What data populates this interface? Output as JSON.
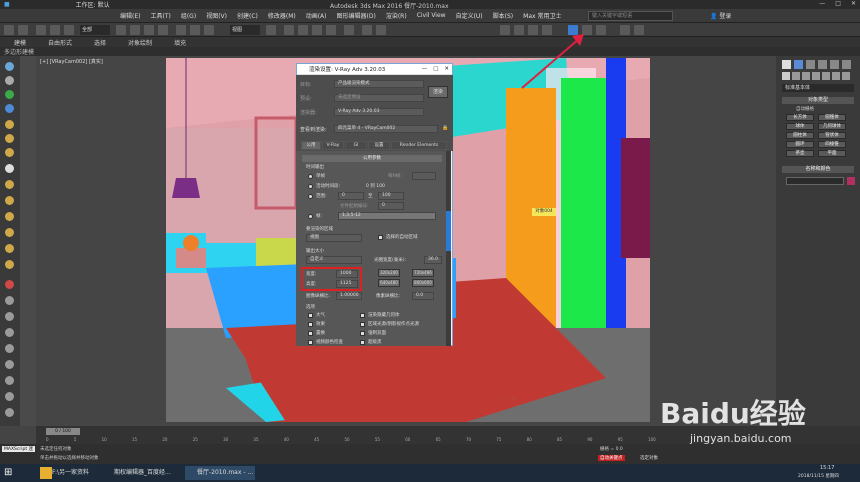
{
  "titlebar": {
    "left": "工作区: 默认",
    "title": "Autodesk 3ds Max 2016    餐厅-2010.max"
  },
  "menubar": {
    "items": [
      "编辑(E)",
      "工具(T)",
      "组(G)",
      "视图(V)",
      "创建(C)",
      "修改器(M)",
      "动画(A)",
      "图形编辑器(D)",
      "渲染(R)",
      "Civil View",
      "自定义(U)",
      "脚本(S)",
      "Max 常用卫士"
    ],
    "search_placeholder": "键入关键字或短语",
    "login": "登录"
  },
  "toolbar": {
    "filter": "全部",
    "view": "视图"
  },
  "ribbon": {
    "tabs": [
      "建模",
      "自由形式",
      "选择",
      "对象绘制",
      "填充"
    ],
    "subtab": "多边形建模"
  },
  "viewport": {
    "label": "[+] [VRayCam002] [真实]",
    "scene_tag": "对象004"
  },
  "render_dialog": {
    "title": "渲染设置: V-Ray Adv 3.20.03",
    "target_label": "目标:",
    "target_value": "产品级渲染模式",
    "preset_label": "预设:",
    "preset_value": "未选定预设",
    "renderer_label": "渲染器:",
    "renderer_value": "V-Ray Adv 3.20.03",
    "view_label": "查看到渲染:",
    "view_value": "四元菜单 4 - VRayCam002",
    "render_button": "渲染",
    "tabs": [
      "公用",
      "V-Ray",
      "GI",
      "设置",
      "Render Elements"
    ],
    "section_common": "公用参数",
    "time_output": "时间输出",
    "single": "单帧",
    "every_nth": "每N帧:",
    "active_segment": "活动时间段:",
    "active_value": "0 到 100",
    "range": "范围:",
    "range_from": "0",
    "to": "至",
    "range_to": "100",
    "file_start": "文件起始编号:",
    "file_start_val": "0",
    "frames": "帧:",
    "frames_value": "1,3,5-12",
    "area_label": "要渲染的区域",
    "area_value": "视图",
    "auto_region": "选择的自动区域",
    "output_size": "输出大小",
    "custom": "自定义",
    "aperture_label": "光圈宽度(毫米):",
    "aperture": "36.0",
    "width_label": "宽度:",
    "width": "1000",
    "height_label": "高度:",
    "height": "1125",
    "presets": [
      "320x240",
      "720x486",
      "640x480",
      "800x600"
    ],
    "image_aspect_label": "图像纵横比:",
    "image_aspect": "1.00000",
    "pixel_aspect_label": "像素纵横比:",
    "pixel_aspect": "0.0",
    "options": "选项",
    "opt_left": [
      "大气",
      "效果",
      "置换",
      "视频颜色检查"
    ],
    "opt_right": [
      "渲染隐藏几何体",
      "区域光源/阴影视作点光源",
      "强制双面",
      "超级黑"
    ]
  },
  "command_panel": {
    "dropdown": "标准基本体",
    "section": "对象类型",
    "autogrid": "自动栅格",
    "buttons": [
      "长方体",
      "圆锥体",
      "球体",
      "几何球体",
      "圆柱体",
      "管状体",
      "圆环",
      "四棱锥",
      "茶壶",
      "平面"
    ],
    "name_color": "名称和颜色"
  },
  "timeline": {
    "frame": "0 / 100",
    "ticks": [
      "0",
      "5",
      "10",
      "15",
      "20",
      "25",
      "30",
      "35",
      "40",
      "45",
      "50",
      "55",
      "60",
      "65",
      "70",
      "75",
      "80",
      "85",
      "90",
      "95",
      "100"
    ]
  },
  "status": {
    "left": "未选定任何对象",
    "hint": "单击并拖动以选择并移动对象",
    "maxscript": "MAXScript 迷",
    "grid": "栅格 = 0.0",
    "autokey": "自动关键点",
    "set_key": "设置关键点",
    "key_filter": "关键点过滤器...",
    "selected": "选定对象"
  },
  "taskbar": {
    "items": [
      "F:\\另一家资料",
      "期权编辑器_百度经...",
      "餐厅-2010.max - ..."
    ],
    "time": "15:17",
    "date": "2018/11/15 星期四"
  },
  "watermark": {
    "brand": "Baidu经验",
    "url": "jingyan.baidu.com"
  },
  "colors": {
    "accent": "#3b7bd0",
    "highlight_box": "#e02020",
    "dialog_border": "#7aa7d8"
  }
}
